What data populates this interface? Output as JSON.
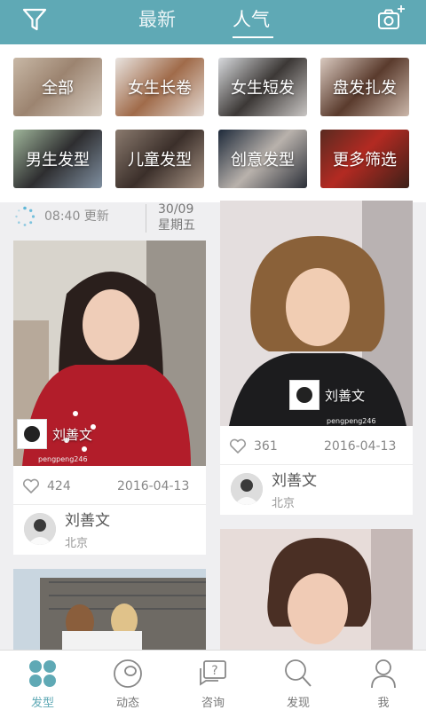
{
  "header": {
    "tabs": [
      "最新",
      "人气"
    ],
    "active_tab": "人气",
    "left_icon": "filter-icon",
    "right_icon": "camera-add-icon"
  },
  "categories": [
    "全部",
    "女生长卷",
    "女生短发",
    "盘发扎发",
    "男生发型",
    "儿童发型",
    "创意发型",
    "更多筛选"
  ],
  "update": {
    "time": "08:40 更新",
    "date": "30/09",
    "weekday": "星期五"
  },
  "posts": [
    {
      "designer": "刘善文",
      "handle": "pengpeng246",
      "likes": "424",
      "date": "2016-04-13",
      "author": "刘善文",
      "city": "北京"
    },
    {
      "designer": "刘善文",
      "handle": "pengpeng246",
      "likes": "361",
      "date": "2016-04-13",
      "author": "刘善文",
      "city": "北京"
    }
  ],
  "tabbar": {
    "items": [
      "发型",
      "动态",
      "咨询",
      "发现",
      "我"
    ],
    "active": "发型",
    "accent": "#5fa9b5"
  }
}
